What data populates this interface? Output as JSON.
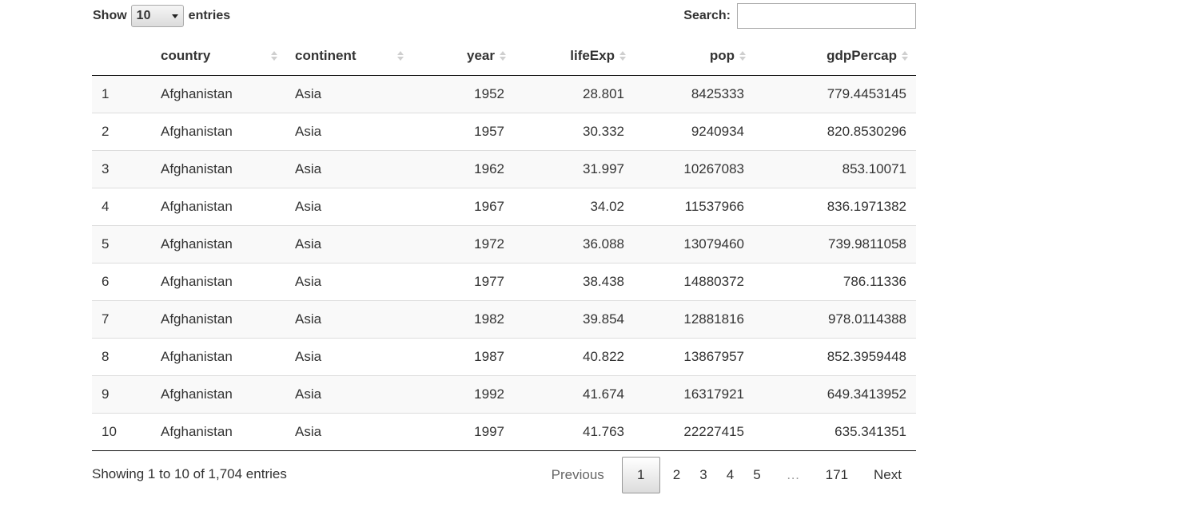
{
  "length": {
    "show_label": "Show",
    "selected": "10",
    "entries_label": "entries"
  },
  "search": {
    "label": "Search:",
    "value": "",
    "placeholder": ""
  },
  "columns": [
    {
      "key": "idx",
      "label": ""
    },
    {
      "key": "country",
      "label": "country"
    },
    {
      "key": "continent",
      "label": "continent"
    },
    {
      "key": "year",
      "label": "year"
    },
    {
      "key": "lifeExp",
      "label": "lifeExp"
    },
    {
      "key": "pop",
      "label": "pop"
    },
    {
      "key": "gdpPercap",
      "label": "gdpPercap"
    }
  ],
  "rows": [
    [
      "1",
      "Afghanistan",
      "Asia",
      "1952",
      "28.801",
      "8425333",
      "779.4453145"
    ],
    [
      "2",
      "Afghanistan",
      "Asia",
      "1957",
      "30.332",
      "9240934",
      "820.8530296"
    ],
    [
      "3",
      "Afghanistan",
      "Asia",
      "1962",
      "31.997",
      "10267083",
      "853.10071"
    ],
    [
      "4",
      "Afghanistan",
      "Asia",
      "1967",
      "34.02",
      "11537966",
      "836.1971382"
    ],
    [
      "5",
      "Afghanistan",
      "Asia",
      "1972",
      "36.088",
      "13079460",
      "739.9811058"
    ],
    [
      "6",
      "Afghanistan",
      "Asia",
      "1977",
      "38.438",
      "14880372",
      "786.11336"
    ],
    [
      "7",
      "Afghanistan",
      "Asia",
      "1982",
      "39.854",
      "12881816",
      "978.0114388"
    ],
    [
      "8",
      "Afghanistan",
      "Asia",
      "1987",
      "40.822",
      "13867957",
      "852.3959448"
    ],
    [
      "9",
      "Afghanistan",
      "Asia",
      "1992",
      "41.674",
      "16317921",
      "649.3413952"
    ],
    [
      "10",
      "Afghanistan",
      "Asia",
      "1997",
      "41.763",
      "22227415",
      "635.341351"
    ]
  ],
  "footer": {
    "info": "Showing 1 to 10 of 1,704 entries",
    "pager": {
      "previous": "Previous",
      "pages": [
        "1",
        "2",
        "3",
        "4",
        "5"
      ],
      "ellipsis": "…",
      "last": "171",
      "next": "Next",
      "current": "1"
    }
  }
}
